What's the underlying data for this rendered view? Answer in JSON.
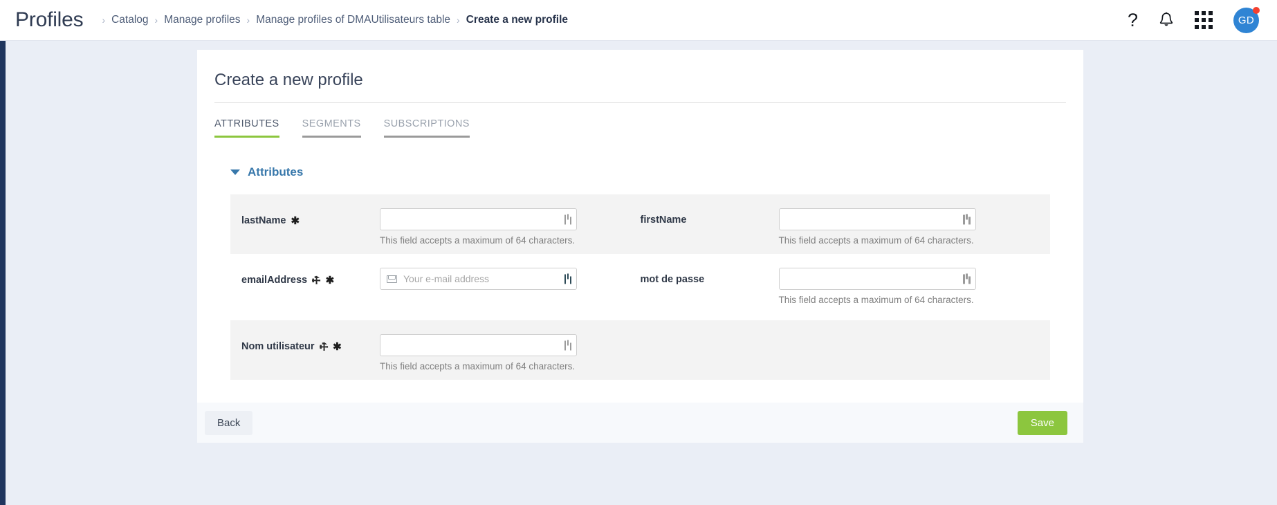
{
  "header": {
    "app_title": "Profiles",
    "breadcrumb": [
      {
        "label": "Catalog",
        "current": false
      },
      {
        "label": "Manage profiles",
        "current": false
      },
      {
        "label": "Manage profiles of DMAUtilisateurs table",
        "current": false
      },
      {
        "label": "Create a new profile",
        "current": true
      }
    ],
    "separator": "›",
    "help_icon": "?",
    "bell_icon": "notifications-bell",
    "apps_icon": "apps-grid",
    "avatar_initials": "GD",
    "avatar_color": "#2f84d4",
    "notification_dot_color": "#f4402f"
  },
  "card": {
    "title": "Create a new profile",
    "tabs": [
      {
        "label": "ATTRIBUTES",
        "active": true
      },
      {
        "label": "SEGMENTS",
        "active": false
      },
      {
        "label": "SUBSCRIPTIONS",
        "active": false
      }
    ],
    "active_tab_color": "#8cc63e",
    "section": {
      "title": "Attributes",
      "color": "#3878ab",
      "expanded": true
    },
    "rows": [
      {
        "shaded": true,
        "left": {
          "label": "lastName",
          "key": false,
          "required": true,
          "value": "",
          "placeholder": "",
          "hint": "This field accepts a maximum of 64 characters.",
          "mail_icon": false,
          "perso_icon": "personalization-icon"
        },
        "right": {
          "label": "firstName",
          "key": false,
          "required": false,
          "value": "",
          "placeholder": "",
          "hint": "This field accepts a maximum of 64 characters.",
          "mail_icon": false,
          "perso_icon": "personalization-icon"
        }
      },
      {
        "shaded": false,
        "left": {
          "label": "emailAddress",
          "key": true,
          "required": true,
          "value": "",
          "placeholder": "Your e-mail address",
          "hint": "",
          "mail_icon": true,
          "perso_icon": "personalization-icon"
        },
        "right": {
          "label": "mot de passe",
          "key": false,
          "required": false,
          "value": "",
          "placeholder": "",
          "hint": "This field accepts a maximum of 64 characters.",
          "mail_icon": false,
          "perso_icon": "personalization-icon"
        }
      },
      {
        "shaded": true,
        "left": {
          "label": "Nom utilisateur",
          "key": true,
          "required": true,
          "value": "",
          "placeholder": "",
          "hint": "This field accepts a maximum of 64 characters.",
          "mail_icon": false,
          "perso_icon": "personalization-icon"
        },
        "right": null
      }
    ]
  },
  "footer": {
    "back_label": "Back",
    "save_label": "Save",
    "save_color": "#8cc63e"
  },
  "glyphs": {
    "key": "⚒",
    "required": "✱"
  }
}
